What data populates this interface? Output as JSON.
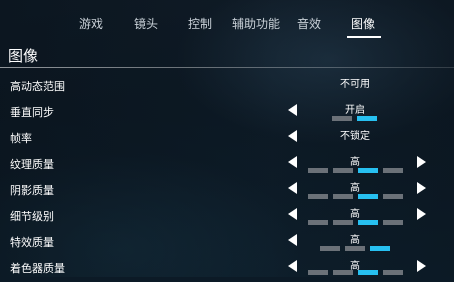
{
  "tabs": [
    {
      "label": "游戏"
    },
    {
      "label": "镜头"
    },
    {
      "label": "控制"
    },
    {
      "label": "辅助功能"
    },
    {
      "label": "音效"
    },
    {
      "label": "图像",
      "active": true
    }
  ],
  "section": {
    "title": "图像"
  },
  "settings": [
    {
      "label": "高动态范围",
      "value": "不可用"
    },
    {
      "label": "垂直同步",
      "value": "开启",
      "level": 2,
      "levels": 2
    },
    {
      "label": "帧率",
      "value": "不锁定"
    },
    {
      "label": "纹理质量",
      "value": "高",
      "level": 3,
      "levels": 4
    },
    {
      "label": "阴影质量",
      "value": "高",
      "level": 3,
      "levels": 4
    },
    {
      "label": "细节级别",
      "value": "高",
      "level": 3,
      "levels": 4
    },
    {
      "label": "特效质量",
      "value": "高",
      "level": 3,
      "levels": 3
    },
    {
      "label": "着色器质量",
      "value": "高",
      "level": 3,
      "levels": 4
    }
  ],
  "colors": {
    "accent": "#27c0f0",
    "segment_off": "#6b7178",
    "background": "#0c1a26"
  },
  "icons": {
    "left": "left-arrow-icon",
    "right": "right-arrow-icon"
  }
}
